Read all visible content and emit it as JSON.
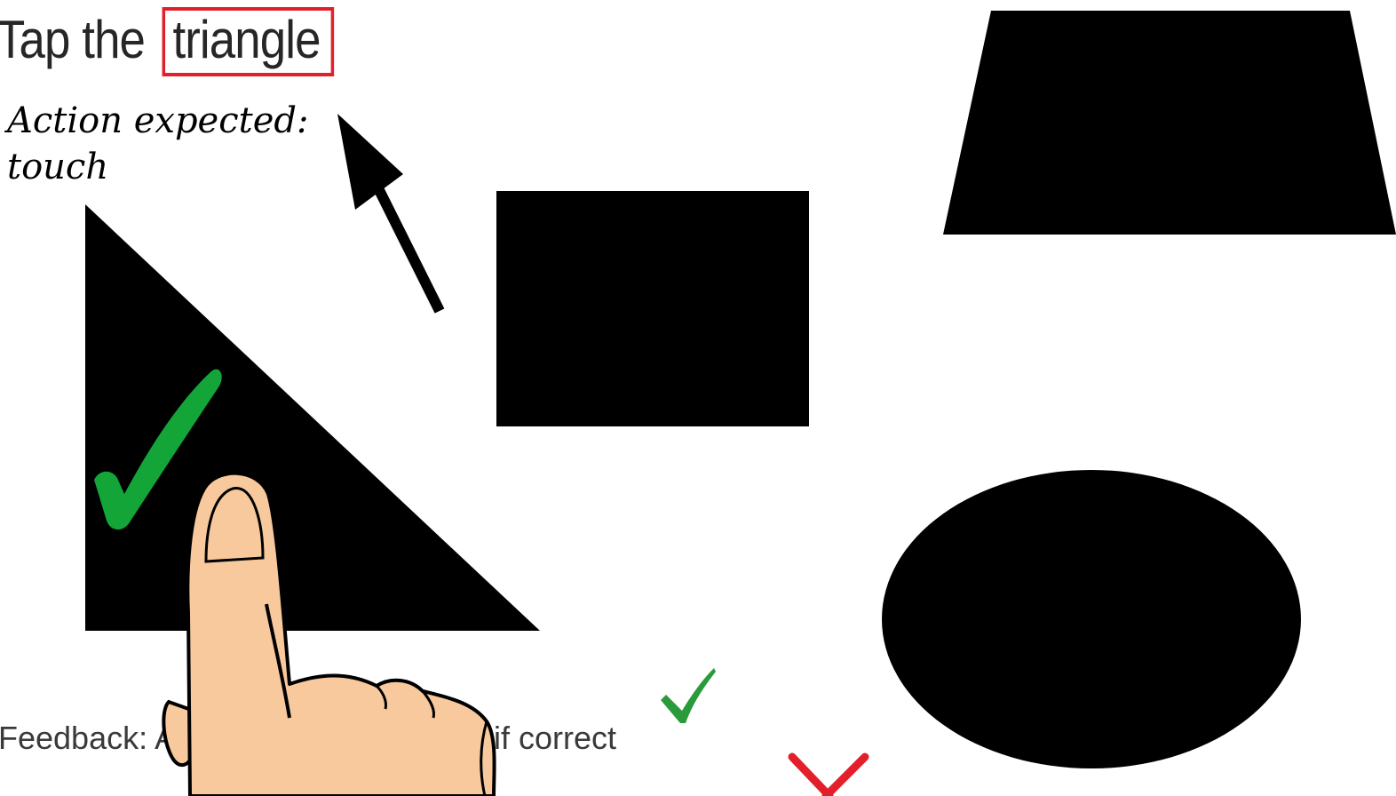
{
  "prompt": {
    "prefix": "Tap the",
    "target_word": "triangle"
  },
  "action_expected": {
    "line1": "Action expected:",
    "line2": "touch"
  },
  "feedback": {
    "visible_start": "Feedback: A",
    "visible_end": "if correct"
  },
  "colors": {
    "highlight_box": "#e2202c",
    "shapes": "#000000",
    "correct_check": "#13a538",
    "small_check": "#2a9a3a",
    "wrong_mark": "#e2202c",
    "skin": "#f7c99c"
  },
  "icons": {
    "pointer_arrow": "arrow-up-left-icon",
    "correct": "checkmark-icon",
    "wrong": "x-mark-icon",
    "hand": "pointing-finger-icon"
  }
}
